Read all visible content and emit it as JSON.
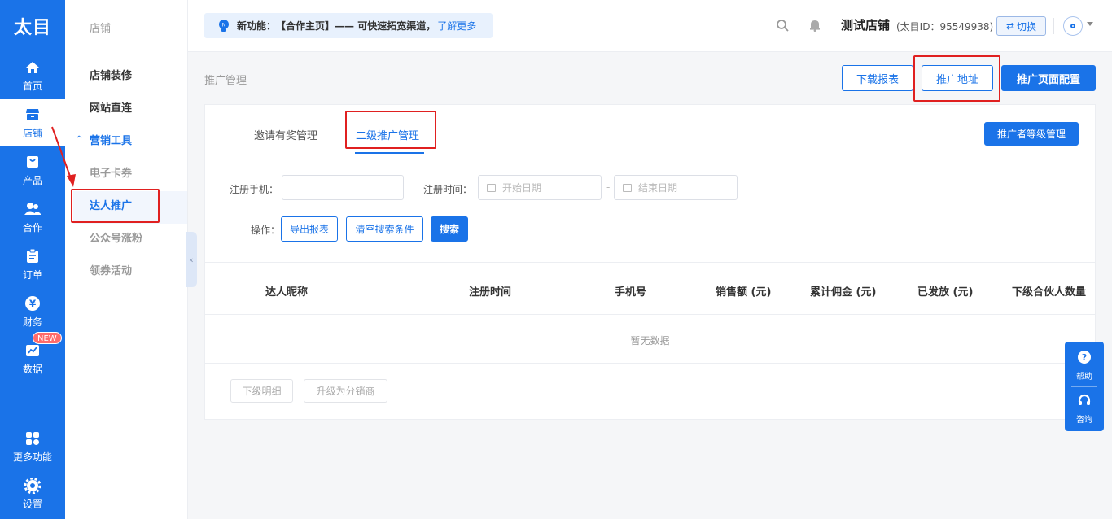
{
  "app": {
    "logo": "太目"
  },
  "rail": {
    "items": [
      {
        "label": "首页",
        "icon": "home-icon"
      },
      {
        "label": "店铺",
        "icon": "store-icon"
      },
      {
        "label": "产品",
        "icon": "bag-icon"
      },
      {
        "label": "合作",
        "icon": "users-icon"
      },
      {
        "label": "订单",
        "icon": "clipboard-icon"
      },
      {
        "label": "财务",
        "icon": "yen-icon"
      },
      {
        "label": "数据",
        "icon": "chart-icon",
        "badge": "NEW"
      },
      {
        "label": "更多功能",
        "icon": "grid-icon"
      },
      {
        "label": "设置",
        "icon": "gear-icon"
      }
    ]
  },
  "submenu": {
    "title": "店铺",
    "items": [
      "店铺装修",
      "网站直连",
      "营销工具",
      "电子卡券",
      "达人推广",
      "公众号涨粉",
      "领券活动"
    ]
  },
  "topbar": {
    "notice_label": "新功能：",
    "notice_text": "【合作主页】—— 可快速拓宽渠道，",
    "notice_link": "了解更多",
    "shop_name": "测试店铺",
    "shop_id": "(太目ID：95549938)",
    "switch_label": "切换"
  },
  "page": {
    "title": "推广管理",
    "buttons": {
      "download": "下载报表",
      "address": "推广地址",
      "config": "推广页面配置"
    },
    "tabs": [
      "邀请有奖管理",
      "二级推广管理"
    ],
    "level_button": "推广者等级管理"
  },
  "filters": {
    "phone_label": "注册手机：",
    "time_label": "注册时间：",
    "start_placeholder": "开始日期",
    "end_placeholder": "结束日期",
    "range_sep": "-",
    "ops_label": "操作：",
    "export": "导出报表",
    "clear": "清空搜索条件",
    "search": "搜索"
  },
  "table": {
    "columns": [
      "达人昵称",
      "注册时间",
      "手机号",
      "销售额 (元)",
      "累计佣金 (元)",
      "已发放 (元)",
      "下级合伙人数量"
    ],
    "empty": "暂无数据"
  },
  "footer_buttons": {
    "detail": "下级明细",
    "upgrade": "升级为分销商"
  },
  "float": {
    "help": "帮助",
    "consult": "咨询"
  },
  "colors": {
    "primary": "#1a73e8",
    "highlight": "#e02020"
  }
}
